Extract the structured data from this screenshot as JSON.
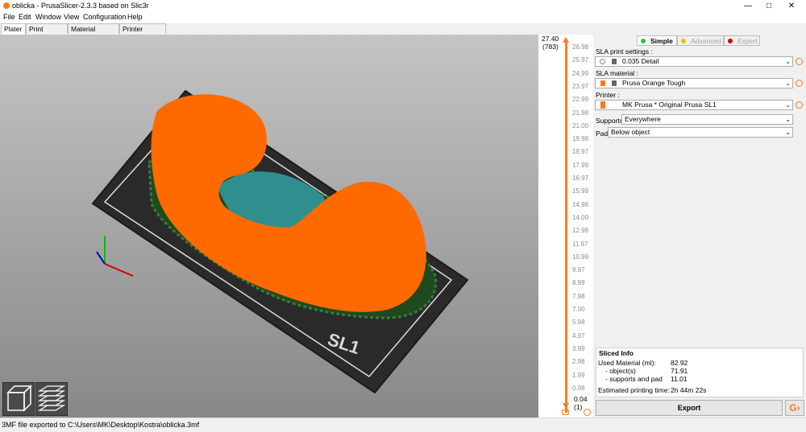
{
  "window": {
    "title": "oblicka - PrusaSlicer-2.3.3 based on Slic3r"
  },
  "menu": [
    "File",
    "Edit",
    "Window",
    "View",
    "Configuration",
    "Help"
  ],
  "tabs": [
    "Plater",
    "Print Settings",
    "Material Settings",
    "Printer Settings"
  ],
  "model": {
    "bed_label": "SL1",
    "object_color": "#ff6a00",
    "support_color": "#2f8f8f",
    "pad_color": "#1f4a1f"
  },
  "layer_slider": {
    "top_value": "27.40",
    "top_layer": "(783)",
    "bottom_value": "0.04",
    "bottom_layer": "(1)",
    "ticks": [
      "26.98",
      "25.97",
      "24.99",
      "23.97",
      "22.99",
      "21.98",
      "21.00",
      "19.98",
      "18.97",
      "17.99",
      "16.97",
      "15.99",
      "14.98",
      "14.00",
      "12.98",
      "11.97",
      "10.99",
      "9.97",
      "8.99",
      "7.98",
      "7.00",
      "5.98",
      "4.97",
      "3.99",
      "2.98",
      "1.99",
      "0.98"
    ]
  },
  "mode": {
    "simple": "Simple",
    "advanced": "Advanced",
    "expert": "Expert"
  },
  "sidebar": {
    "print_label": "SLA print settings :",
    "print_value": "0.035 Detail",
    "material_label": "SLA material :",
    "material_value": "Prusa Orange Tough",
    "printer_label": "Printer :",
    "printer_value": "MK Prusa * Original Prusa SL1",
    "supports_label": "Supports:",
    "supports_value": "Everywhere",
    "pad_label": "Pad:",
    "pad_value": "Below object"
  },
  "sliced_info": {
    "title": "Sliced Info",
    "used_material_label": "Used Material (ml):",
    "used_material_value": "82.92",
    "objects_label": "- object(s)",
    "objects_value": "71.91",
    "supports_label": "- supports and pad",
    "supports_value": "11.01",
    "time_label": "Estimated printing time:",
    "time_value": "2h 44m 22s"
  },
  "export_label": "Export",
  "status": "3MF file exported to C:\\Users\\MK\\Desktop\\Kostra\\oblicka.3mf"
}
